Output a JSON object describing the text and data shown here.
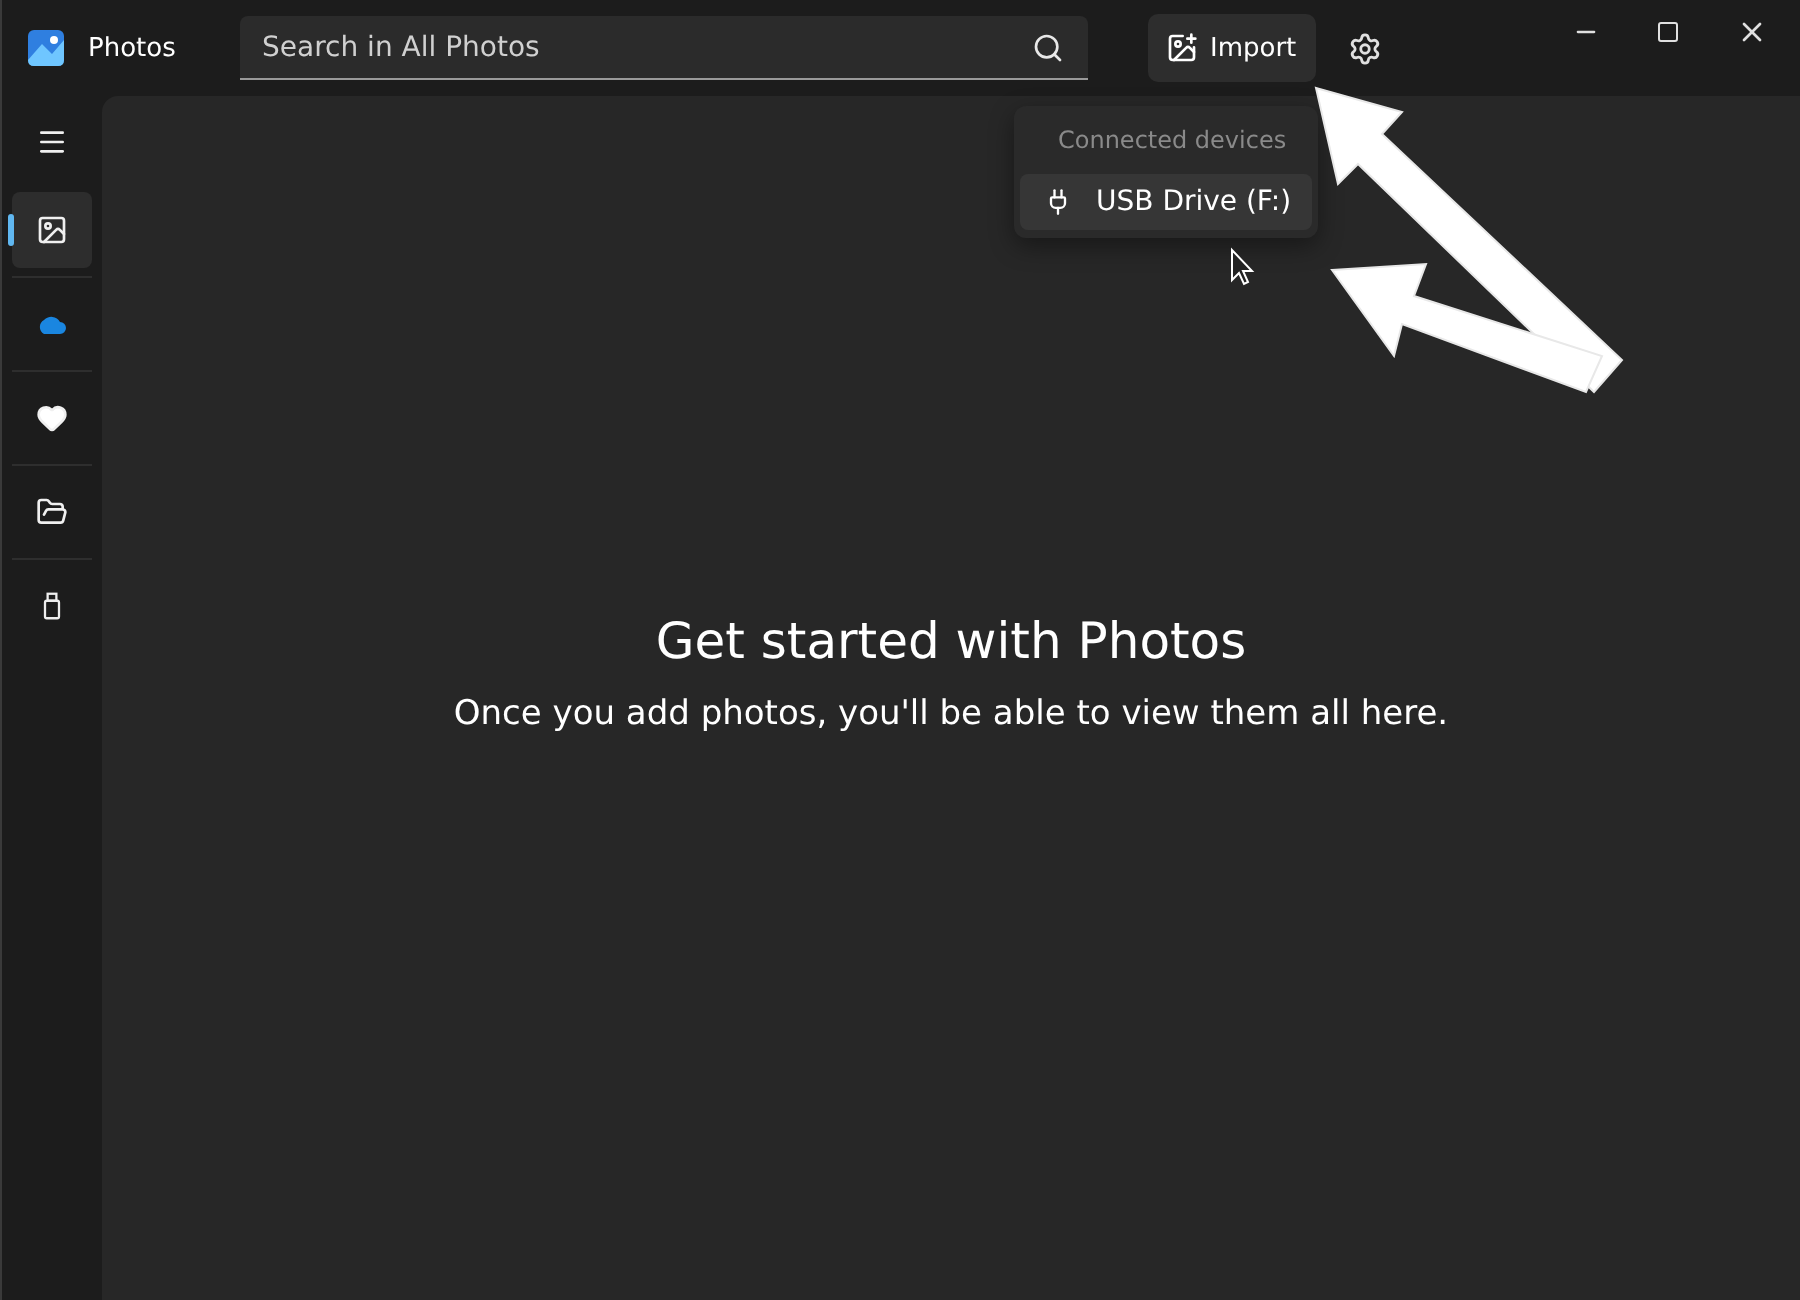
{
  "window": {
    "title": "Photos"
  },
  "search": {
    "placeholder": "Search in All Photos"
  },
  "import_button": {
    "label": "Import"
  },
  "sidebar": {
    "items": [
      {
        "kind": "menu",
        "selected": false
      },
      {
        "kind": "photos",
        "selected": true
      },
      {
        "kind": "cloud",
        "selected": false
      },
      {
        "kind": "favorites",
        "selected": false
      },
      {
        "kind": "folders",
        "selected": false
      },
      {
        "kind": "device",
        "selected": false
      }
    ]
  },
  "import_menu": {
    "heading": "Connected devices",
    "items": [
      {
        "label": "USB Drive (F:)",
        "selected": true
      }
    ]
  },
  "empty_state": {
    "title": "Get started with Photos",
    "message": "Once you add photos, you'll be able to view them all here."
  }
}
